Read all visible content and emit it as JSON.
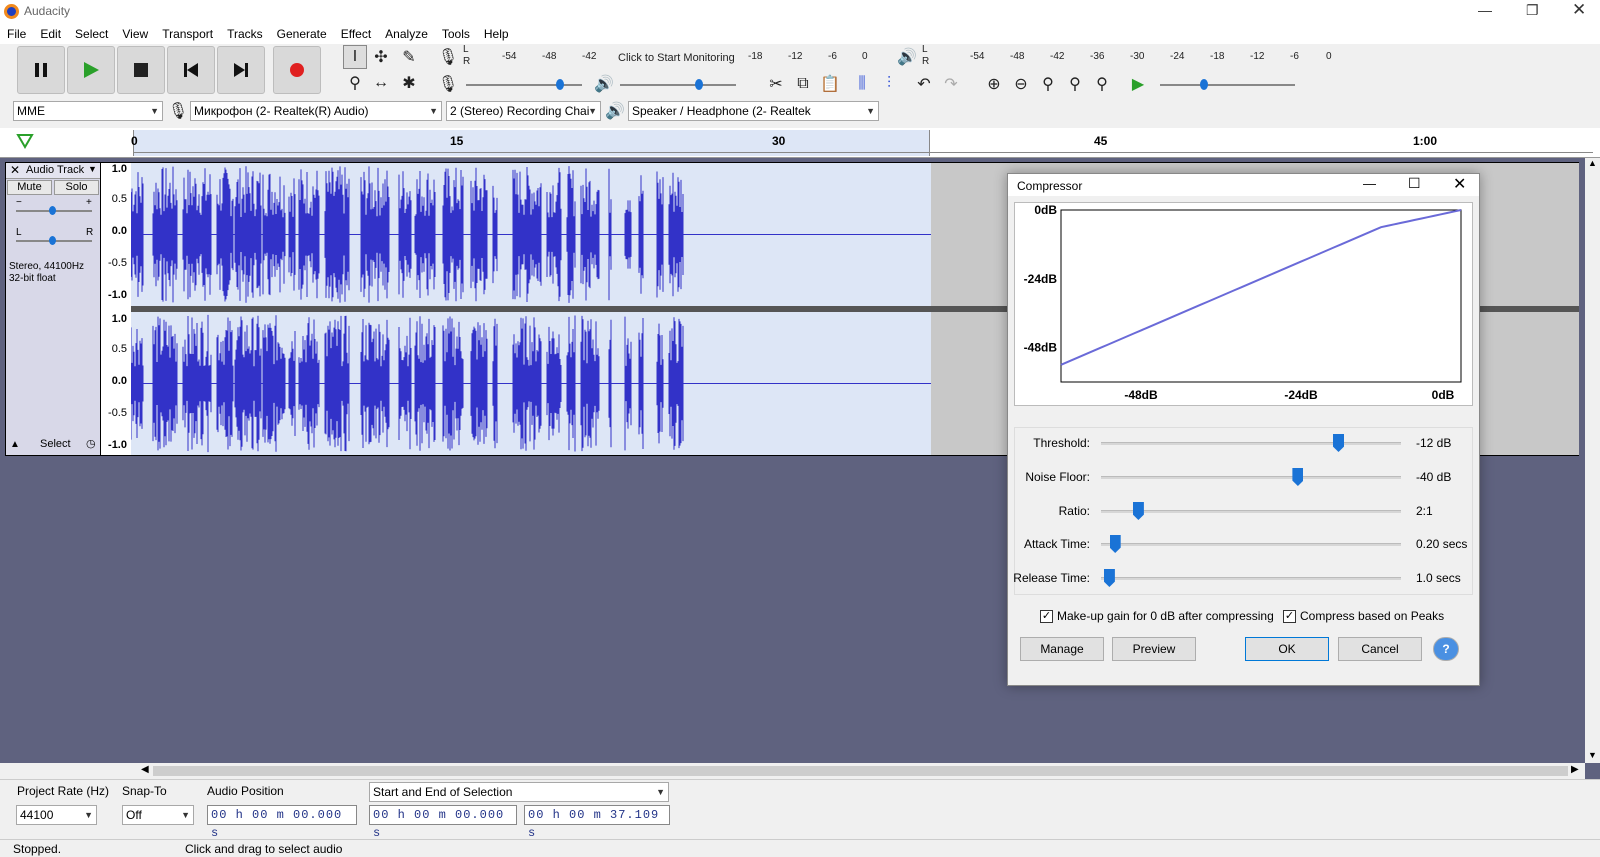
{
  "app": {
    "title": "Audacity"
  },
  "menu": [
    "File",
    "Edit",
    "Select",
    "View",
    "Transport",
    "Tracks",
    "Generate",
    "Effect",
    "Analyze",
    "Tools",
    "Help"
  ],
  "meters": {
    "record_ticks": [
      "-54",
      "-48",
      "-42",
      "-18",
      "-12",
      "-6",
      "0"
    ],
    "record_prompt": "Click to Start Monitoring",
    "play_ticks": [
      "-54",
      "-48",
      "-42",
      "-36",
      "-30",
      "-24",
      "-18",
      "-12",
      "-6",
      "0"
    ],
    "lr_top": "L",
    "lr_bottom": "R"
  },
  "devices": {
    "host": "MME",
    "mic": "Микрофон (2- Realtek(R) Audio)",
    "channels": "2 (Stereo) Recording Chai",
    "speaker": "Speaker / Headphone (2- Realtek"
  },
  "ruler": {
    "ticks": [
      "0",
      "15",
      "30",
      "45",
      "1:00"
    ]
  },
  "track": {
    "name": "Audio Track",
    "mute": "Mute",
    "solo": "Solo",
    "gain_minus": "−",
    "gain_plus": "+",
    "pan_l": "L",
    "pan_r": "R",
    "info_line1": "Stereo, 44100Hz",
    "info_line2": "32-bit float",
    "select": "Select",
    "scale": [
      "1.0",
      "0.5",
      "0.0",
      "-0.5",
      "-1.0"
    ]
  },
  "dialog": {
    "title": "Compressor",
    "graph": {
      "y_labels": [
        "0dB",
        "-24dB",
        "-48dB"
      ],
      "x_labels": [
        "-48dB",
        "-24dB",
        "0dB"
      ],
      "threshold_db": -12,
      "ratio": 2
    },
    "controls": [
      {
        "label": "Threshold:",
        "value": "-12 dB",
        "fraction": 0.8
      },
      {
        "label": "Noise Floor:",
        "value": "-40 dB",
        "fraction": 0.66
      },
      {
        "label": "Ratio:",
        "value": "2:1",
        "fraction": 0.11
      },
      {
        "label": "Attack Time:",
        "value": "0.20 secs",
        "fraction": 0.03
      },
      {
        "label": "Release Time:",
        "value": "1.0 secs",
        "fraction": 0.01
      }
    ],
    "makeup_gain": "Make-up gain for 0 dB after compressing",
    "peaks": "Compress based on Peaks",
    "buttons": {
      "manage": "Manage",
      "preview": "Preview",
      "ok": "OK",
      "cancel": "Cancel",
      "help": "?"
    }
  },
  "bottom": {
    "project_rate_label": "Project Rate (Hz)",
    "project_rate": "44100",
    "snap_label": "Snap-To",
    "snap": "Off",
    "audio_pos_label": "Audio Position",
    "audio_pos": "00 h 00 m 00.000 s",
    "selection_mode": "Start and End of Selection",
    "sel_start": "00 h 00 m 00.000 s",
    "sel_end": "00 h 00 m 37.109 s"
  },
  "status": {
    "state": "Stopped.",
    "hint": "Click and drag to select audio"
  },
  "colors": {
    "wave": "#3232c8",
    "selection_bg": "#dde6f6",
    "record": "#e02020",
    "play": "#2aa02a",
    "accent": "#1a73d6"
  }
}
